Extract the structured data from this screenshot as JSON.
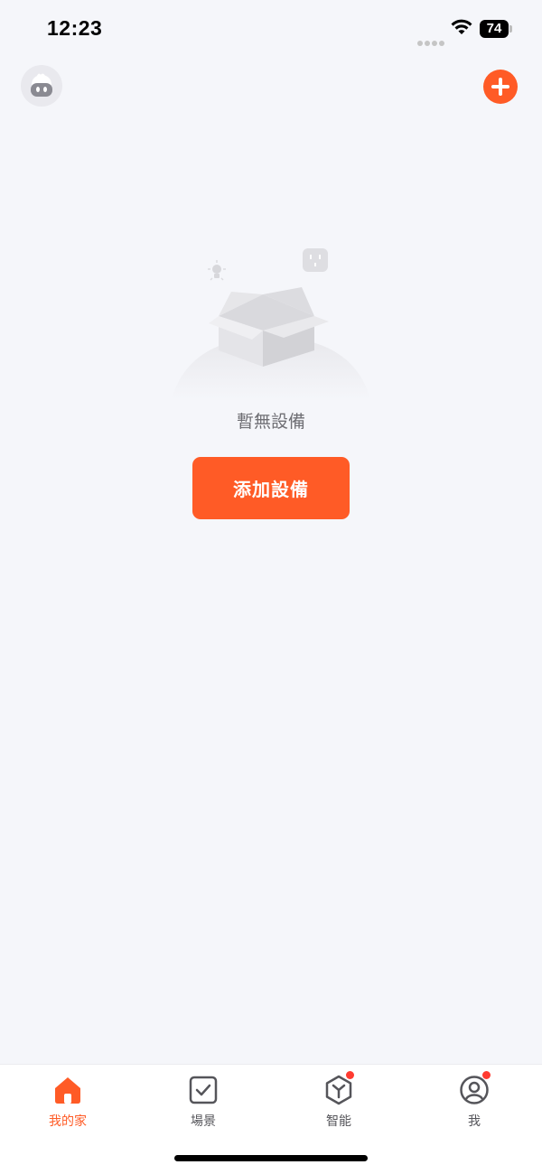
{
  "status_bar": {
    "time": "12:23",
    "battery": "74"
  },
  "header": {
    "avatar_icon": "robot-avatar-icon",
    "add_icon": "plus-circle-icon"
  },
  "empty_state": {
    "message": "暫無設備",
    "button_label": "添加設備"
  },
  "tab_bar": {
    "tabs": [
      {
        "label": "我的家",
        "icon": "home-icon",
        "active": true
      },
      {
        "label": "場景",
        "icon": "checkbox-icon",
        "active": false
      },
      {
        "label": "智能",
        "icon": "hexagon-y-icon",
        "active": false,
        "badge": true
      },
      {
        "label": "我",
        "icon": "profile-icon",
        "active": false,
        "badge": true
      }
    ]
  },
  "colors": {
    "accent": "#ff5b26",
    "background": "#f5f6fa",
    "badge": "#ff3b30"
  }
}
